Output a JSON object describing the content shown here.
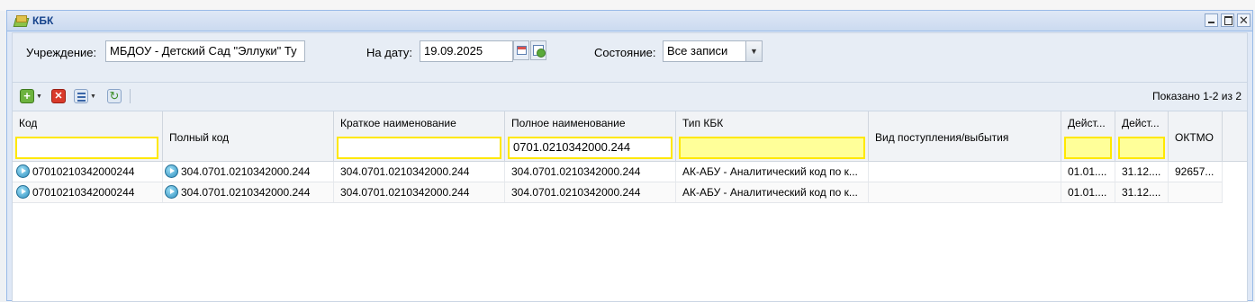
{
  "window": {
    "title": "КБК"
  },
  "filters": {
    "institution_label": "Учреждение:",
    "institution_value": "МБДОУ - Детский Сад \"Эллуки\" Ту",
    "date_label": "На дату:",
    "date_value": "19.09.2025",
    "state_label": "Состояние:",
    "state_value": "Все записи"
  },
  "toolbar": {
    "shown_text": "Показано 1-2 из 2"
  },
  "grid": {
    "columns": [
      {
        "label": "Код"
      },
      {
        "label": "Полный код"
      },
      {
        "label": "Краткое наименование"
      },
      {
        "label": "Полное наименование"
      },
      {
        "label": "Тип КБК"
      },
      {
        "label": "Вид поступления/выбытия"
      },
      {
        "label": "Дейст..."
      },
      {
        "label": "Дейст..."
      },
      {
        "label": "ОКТМО"
      }
    ],
    "column_filters": {
      "full_name": "0701.0210342000.244"
    },
    "rows": [
      [
        "07010210342000244",
        "304.0701.0210342000.244",
        "304.0701.0210342000.244",
        "304.0701.0210342000.244",
        "АК-АБУ - Аналитический код по к...",
        "",
        "01.01....",
        "31.12....",
        "92657..."
      ],
      [
        "07010210342000244",
        "304.0701.0210342000.244",
        "304.0701.0210342000.244",
        "304.0701.0210342000.244",
        "АК-АБУ - Аналитический код по к...",
        "",
        "01.01....",
        "31.12....",
        ""
      ]
    ]
  },
  "colors": {
    "filter_highlight": "#ffe800",
    "filter_fill": "#ffff99",
    "title_text": "#15428b"
  }
}
